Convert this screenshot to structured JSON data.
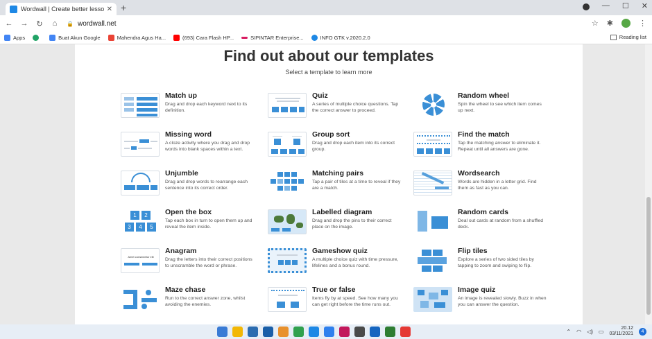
{
  "browser": {
    "tab_title": "Wordwall | Create better lessons",
    "url": "wordwall.net",
    "bookmarks": [
      {
        "label": "Apps",
        "color": "#4285f4"
      },
      {
        "label": "",
        "color": "#21a366"
      },
      {
        "label": "Buat Akun Google",
        "color": "#4285f4"
      },
      {
        "label": "Mahendra Agus Ha...",
        "color": "#ea4335"
      },
      {
        "label": "(693) Cara Flash HP...",
        "color": "#ff0000"
      },
      {
        "label": "SIPINTAR Enterprise...",
        "color": "#d81b60"
      },
      {
        "label": "INFO GTK v.2020.2.0",
        "color": "#1e88e5"
      }
    ],
    "reading_list": "Reading list"
  },
  "page": {
    "heading": "Find out about our templates",
    "subheading": "Select a template to learn more"
  },
  "templates": [
    {
      "title": "Match up",
      "desc": "Drag and drop each keyword next to its definition."
    },
    {
      "title": "Quiz",
      "desc": "A series of multiple choice questions. Tap the correct answer to proceed."
    },
    {
      "title": "Random wheel",
      "desc": "Spin the wheel to see which item comes up next."
    },
    {
      "title": "Missing word",
      "desc": "A cloze activity where you drag and drop words into blank spaces within a text."
    },
    {
      "title": "Group sort",
      "desc": "Drag and drop each item into its correct group."
    },
    {
      "title": "Find the match",
      "desc": "Tap the matching answer to eliminate it. Repeat until all answers are gone."
    },
    {
      "title": "Unjumble",
      "desc": "Drag and drop words to rearrange each sentence into its correct order."
    },
    {
      "title": "Matching pairs",
      "desc": "Tap a pair of tiles at a time to reveal if they are a match."
    },
    {
      "title": "Wordsearch",
      "desc": "Words are hidden in a letter grid. Find them as fast as you can."
    },
    {
      "title": "Open the box",
      "desc": "Tap each box in turn to open them up and reveal the item inside."
    },
    {
      "title": "Labelled diagram",
      "desc": "Drag and drop the pins to their correct place on the image."
    },
    {
      "title": "Random cards",
      "desc": "Deal out cards at random from a shuffled deck."
    },
    {
      "title": "Anagram",
      "desc": "Drag the letters into their correct positions to unscramble the word or phrase."
    },
    {
      "title": "Gameshow quiz",
      "desc": "A multiple choice quiz with time pressure, lifelines and a bonus round."
    },
    {
      "title": "Flip tiles",
      "desc": "Explore a series of two sided tiles by tapping to zoom and swiping to flip."
    },
    {
      "title": "Maze chase",
      "desc": "Run to the correct answer zone, whilst avoiding the enemies."
    },
    {
      "title": "True or false",
      "desc": "Items fly by at speed. See how many you can get right before the time runs out."
    },
    {
      "title": "Image quiz",
      "desc": "An image is revealed slowly. Buzz in when you can answer the question."
    }
  ],
  "thumb_words": {
    "box_numbers": [
      "1",
      "2",
      "3",
      "4",
      "5"
    ],
    "anagram_caption": "Amet consectetur elit"
  },
  "taskbar": {
    "time": "20.12",
    "date": "03/11/2021",
    "notifications": "4",
    "apps": [
      "#3a7bd5",
      "#f2b705",
      "#2b6cb0",
      "#1b5fa8",
      "#e8912d",
      "#30a14e",
      "#1e88e5",
      "#2f80ed",
      "#c2185b",
      "#4a4a4a",
      "#1565c0",
      "#2e7d32",
      "#e53935"
    ]
  },
  "colors": {
    "accent": "#3a8fd6"
  }
}
